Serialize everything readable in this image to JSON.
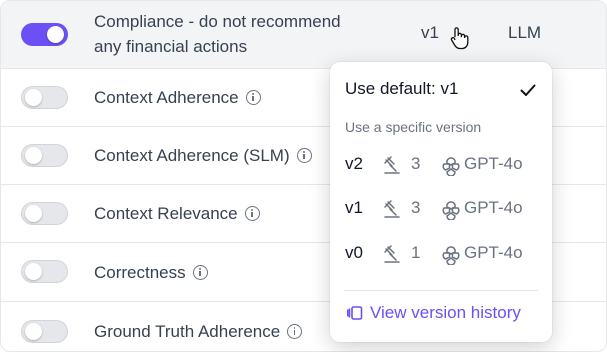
{
  "metrics": [
    {
      "label_lines": [
        "Compliance - do not recommend",
        "any financial actions"
      ],
      "enabled": true,
      "version": "v1",
      "model_type": "LLM"
    },
    {
      "label": "Context Adherence",
      "enabled": false
    },
    {
      "label": "Context Adherence (SLM)",
      "enabled": false
    },
    {
      "label": "Context Relevance",
      "enabled": false
    },
    {
      "label": "Correctness",
      "enabled": false
    },
    {
      "label": "Ground Truth Adherence",
      "enabled": false
    }
  ],
  "dropdown": {
    "default_label": "Use default: v1",
    "section_label": "Use a specific version",
    "versions": [
      {
        "name": "v2",
        "count": "3",
        "model": "GPT-4o"
      },
      {
        "name": "v1",
        "count": "3",
        "model": "GPT-4o"
      },
      {
        "name": "v0",
        "count": "1",
        "model": "GPT-4o"
      }
    ],
    "history_label": "View version history"
  },
  "colors": {
    "accent": "#6d4ff6",
    "toggle_off": "#e5e7eb",
    "row_hover": "#f3f4f6"
  }
}
